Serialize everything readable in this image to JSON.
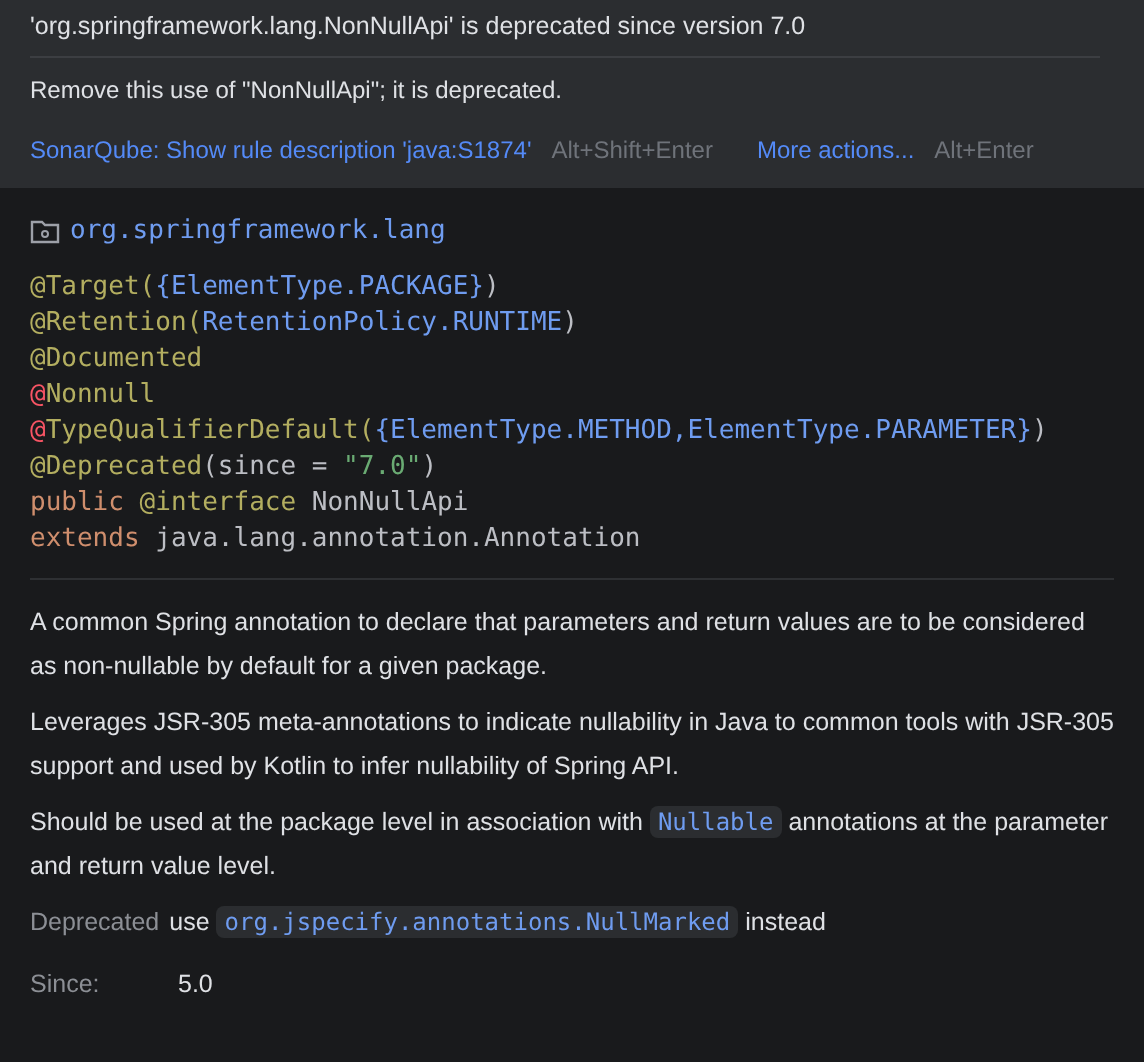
{
  "warning": {
    "title": "'org.springframework.lang.NonNullApi' is deprecated since version 7.0",
    "message": "Remove this use of \"NonNullApi\"; it is deprecated.",
    "actions": [
      {
        "label": "SonarQube: Show rule description 'java:S1874'",
        "shortcut": "Alt+Shift+Enter"
      },
      {
        "label": "More actions...",
        "shortcut": "Alt+Enter"
      }
    ]
  },
  "doc": {
    "package": "org.springframework.lang",
    "code_lines": [
      [
        {
          "kind": "annotation",
          "text": "@Target("
        },
        {
          "kind": "type",
          "text": "{ElementType.PACKAGE}"
        },
        {
          "kind": "plain",
          "text": ")"
        }
      ],
      [
        {
          "kind": "annotation",
          "text": "@Retention("
        },
        {
          "kind": "type",
          "text": "RetentionPolicy.RUNTIME"
        },
        {
          "kind": "plain",
          "text": ")"
        }
      ],
      [
        {
          "kind": "annotation",
          "text": "@Documented"
        }
      ],
      [
        {
          "kind": "error",
          "text": "@"
        },
        {
          "kind": "annotation",
          "text": "Nonnull"
        }
      ],
      [
        {
          "kind": "error",
          "text": "@"
        },
        {
          "kind": "annotation",
          "text": "TypeQualifierDefault("
        },
        {
          "kind": "type",
          "text": "{ElementType.METHOD,ElementType.PARAMETER}"
        },
        {
          "kind": "plain",
          "text": ")"
        }
      ],
      [
        {
          "kind": "annotation",
          "text": "@Deprecated"
        },
        {
          "kind": "plain",
          "text": "(since = "
        },
        {
          "kind": "string",
          "text": "\"7.0\""
        },
        {
          "kind": "plain",
          "text": ")"
        }
      ],
      [
        {
          "kind": "keyword",
          "text": "public "
        },
        {
          "kind": "annotation",
          "text": "@interface"
        },
        {
          "kind": "plain",
          "text": " NonNullApi"
        }
      ],
      [
        {
          "kind": "keyword",
          "text": "extends "
        },
        {
          "kind": "plain",
          "text": "java.lang.annotation.Annotation"
        }
      ]
    ],
    "paragraphs": [
      [
        {
          "kind": "text",
          "text": "A common Spring annotation to declare that parameters and return values are to be considered as non-nullable by default for a given package."
        }
      ],
      [
        {
          "kind": "text",
          "text": "Leverages JSR-305 meta-annotations to indicate nullability in Java to common tools with JSR-305 support and used by Kotlin to infer nullability of Spring API."
        }
      ],
      [
        {
          "kind": "text",
          "text": "Should be used at the package level in association with "
        },
        {
          "kind": "code",
          "text": "Nullable"
        },
        {
          "kind": "text",
          "text": " annotations at the parameter and return value level."
        }
      ]
    ],
    "deprecated": {
      "label": "Deprecated",
      "parts": [
        {
          "kind": "text",
          "text": "use "
        },
        {
          "kind": "code",
          "text": "org.jspecify.annotations.NullMarked"
        },
        {
          "kind": "text",
          "text": " instead"
        }
      ]
    },
    "since": {
      "label": "Since:",
      "value": "5.0"
    }
  }
}
